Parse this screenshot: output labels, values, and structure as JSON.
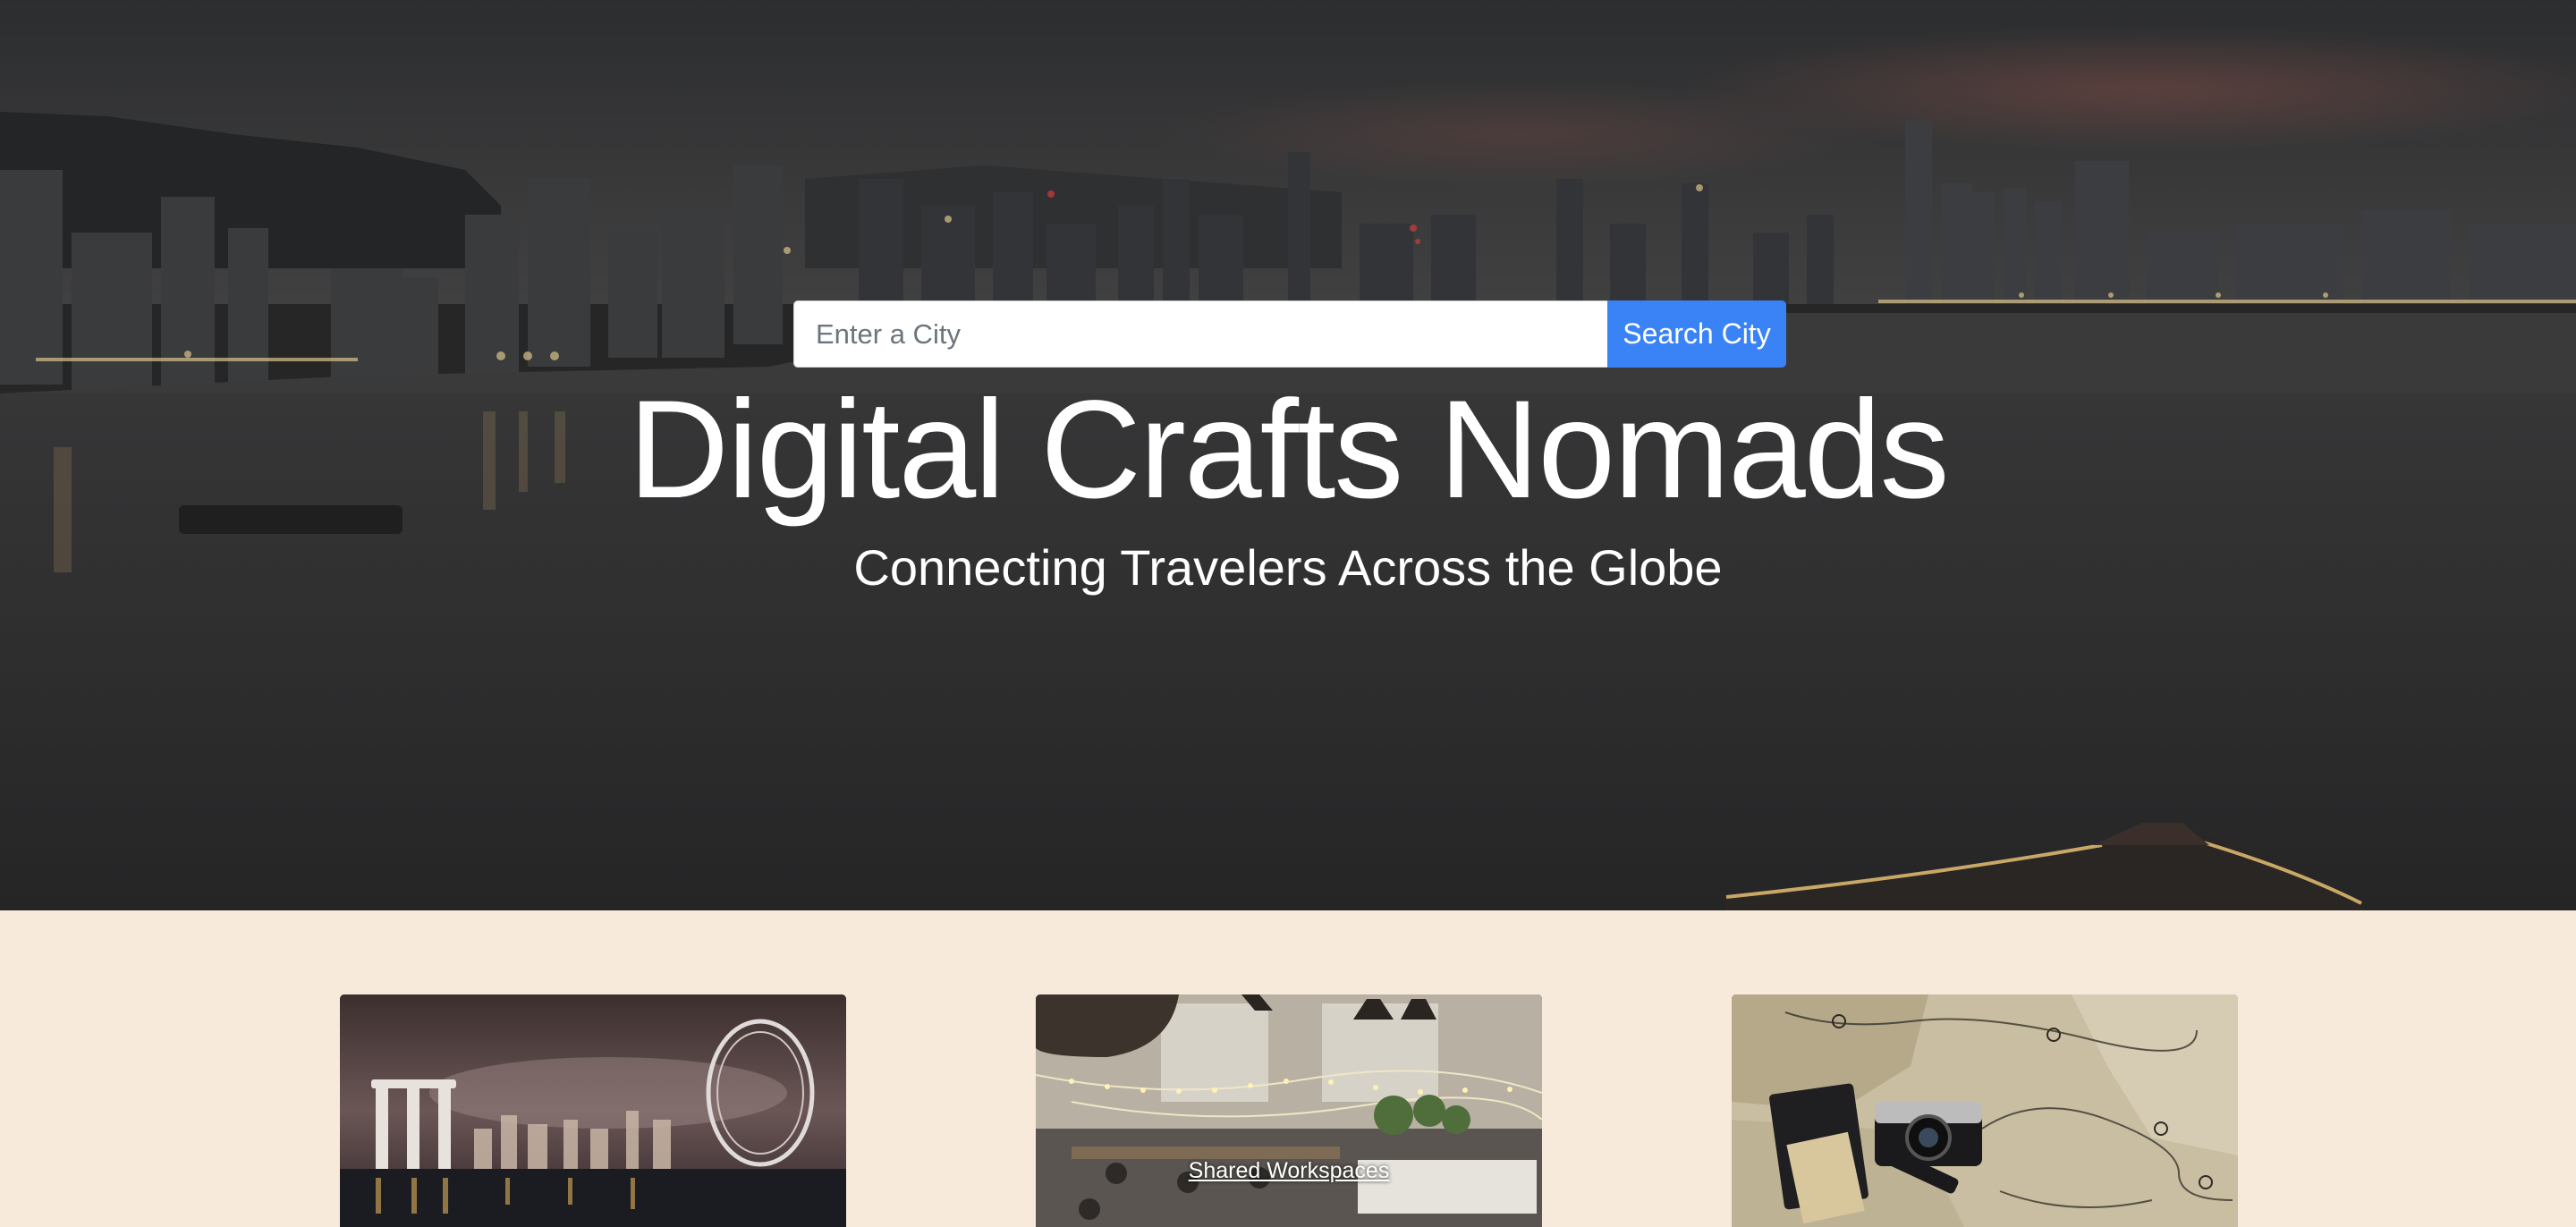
{
  "hero": {
    "search": {
      "placeholder": "Enter a City",
      "value": "",
      "button_label": "Search City"
    },
    "title": "Digital Crafts Nomads",
    "subtitle": "Connecting Travelers Across the Globe"
  },
  "cards": [
    {
      "image": "city-skyline-night-photo",
      "caption": ""
    },
    {
      "image": "coworking-space-photo",
      "caption": "Shared Workspaces"
    },
    {
      "image": "travel-map-camera-passport-photo",
      "caption": ""
    }
  ],
  "colors": {
    "page_background": "#f8eadb",
    "button": "#3a83f7",
    "hero_text": "#ffffff"
  }
}
